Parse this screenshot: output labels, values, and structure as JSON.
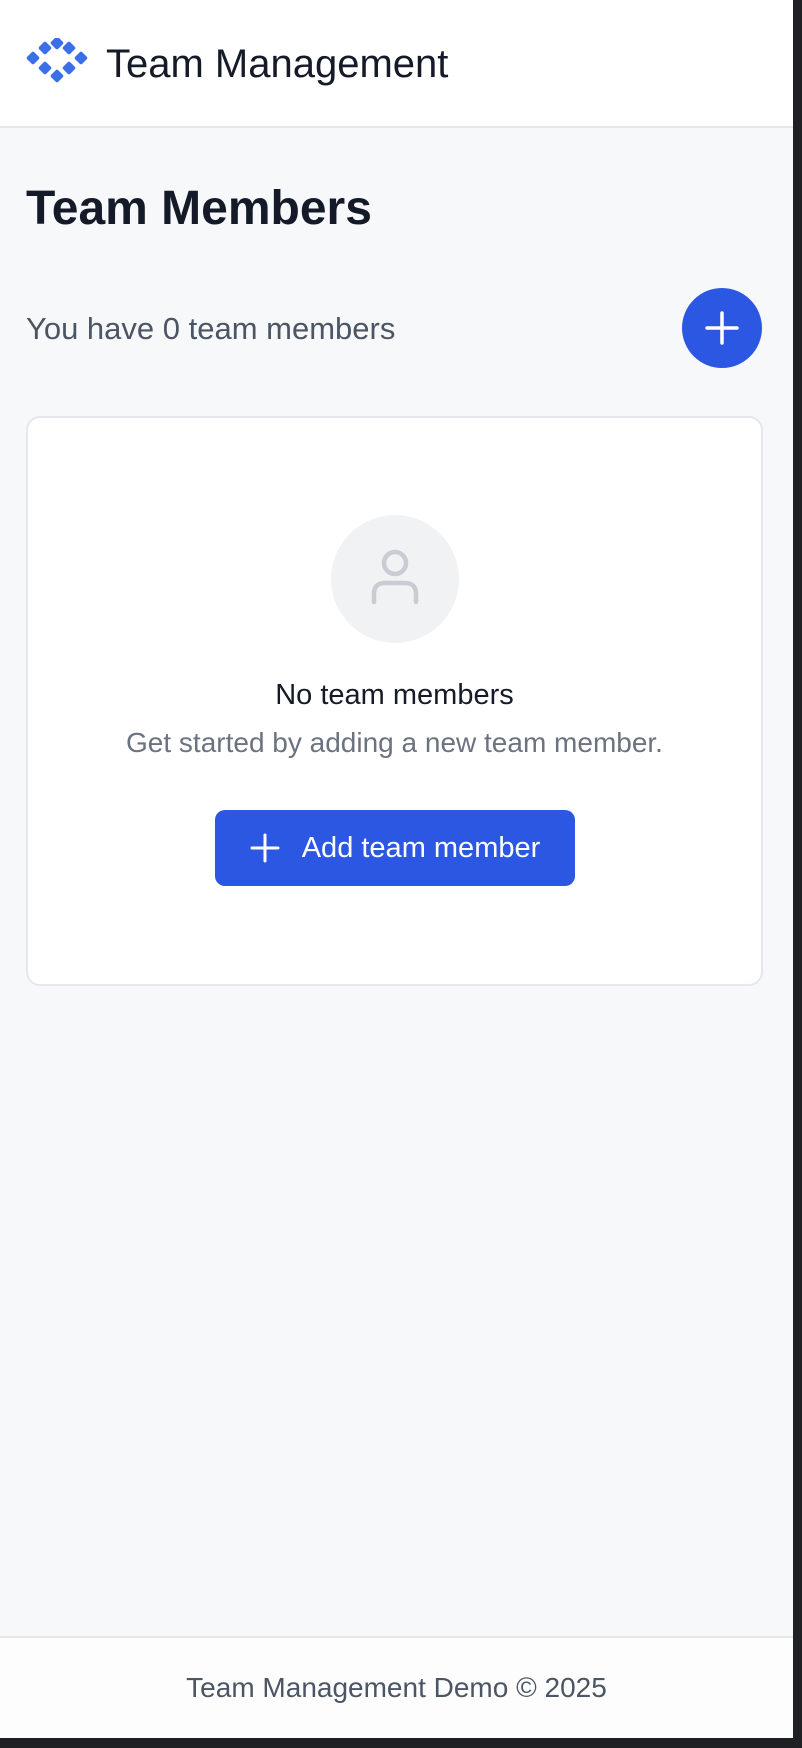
{
  "header": {
    "logo_icon": "diamond-cluster-logo-icon",
    "title": "Team Management"
  },
  "main": {
    "page_title": "Team Members",
    "member_count_text": "You have 0 team members",
    "add_fab_icon": "plus-icon",
    "empty_state": {
      "icon": "user-icon",
      "title": "No team members",
      "subtitle": "Get started by adding a new team member.",
      "button_icon": "plus-icon",
      "button_label": "Add team member"
    }
  },
  "footer": {
    "text": "Team Management Demo © 2025"
  },
  "colors": {
    "accent": "#2b57e3",
    "logo": "#3b6fe8",
    "background": "#f7f8fa",
    "card": "#ffffff",
    "text_primary": "#151a28",
    "text_secondary": "#6b7280"
  }
}
